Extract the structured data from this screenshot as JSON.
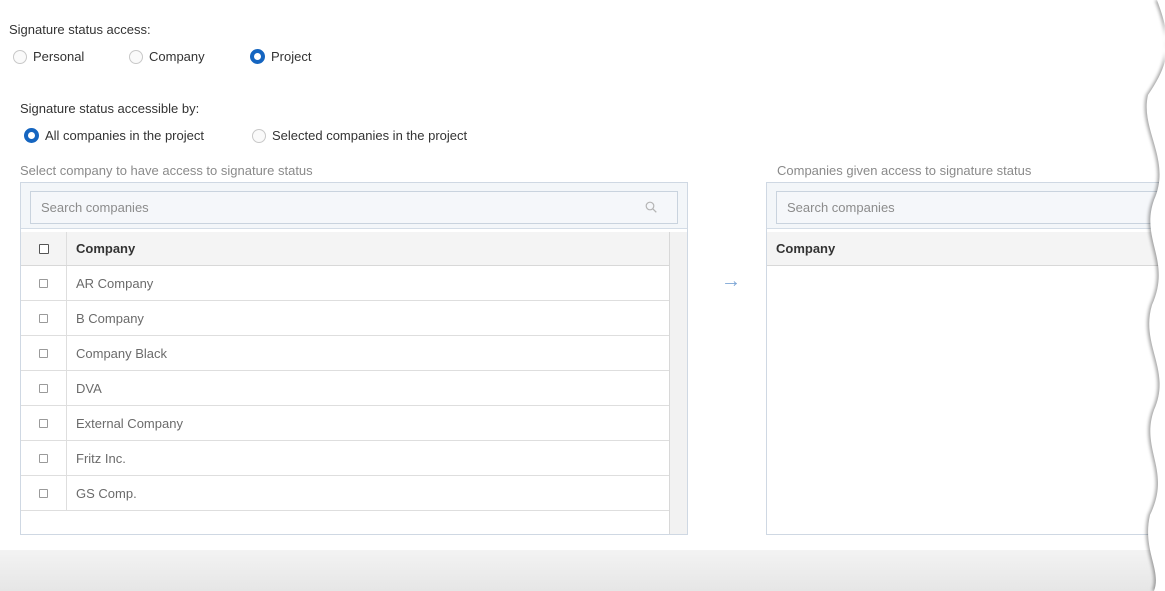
{
  "access": {
    "title": "Signature status access:",
    "options": [
      {
        "label": "Personal",
        "selected": false
      },
      {
        "label": "Company",
        "selected": false
      },
      {
        "label": "Project",
        "selected": true
      }
    ]
  },
  "accessible_by": {
    "title": "Signature status accessible by:",
    "options": [
      {
        "label": "All companies in the project",
        "selected": true
      },
      {
        "label": "Selected companies in the project",
        "selected": false
      }
    ]
  },
  "left_panel": {
    "caption": "Select company to have access to signature status",
    "search_placeholder": "Search companies",
    "column_header": "Company",
    "rows": [
      "AR Company",
      "B Company",
      "Company Black",
      "DVA",
      "External Company",
      "Fritz Inc.",
      "GS Comp."
    ]
  },
  "right_panel": {
    "caption": "Companies given access to signature status",
    "search_placeholder": "Search companies",
    "column_header": "Company"
  },
  "colors": {
    "accent": "#1565c0",
    "arrow": "#7da6d6"
  },
  "icons": {
    "search": "search-icon",
    "transfer": "arrow-right-icon"
  }
}
